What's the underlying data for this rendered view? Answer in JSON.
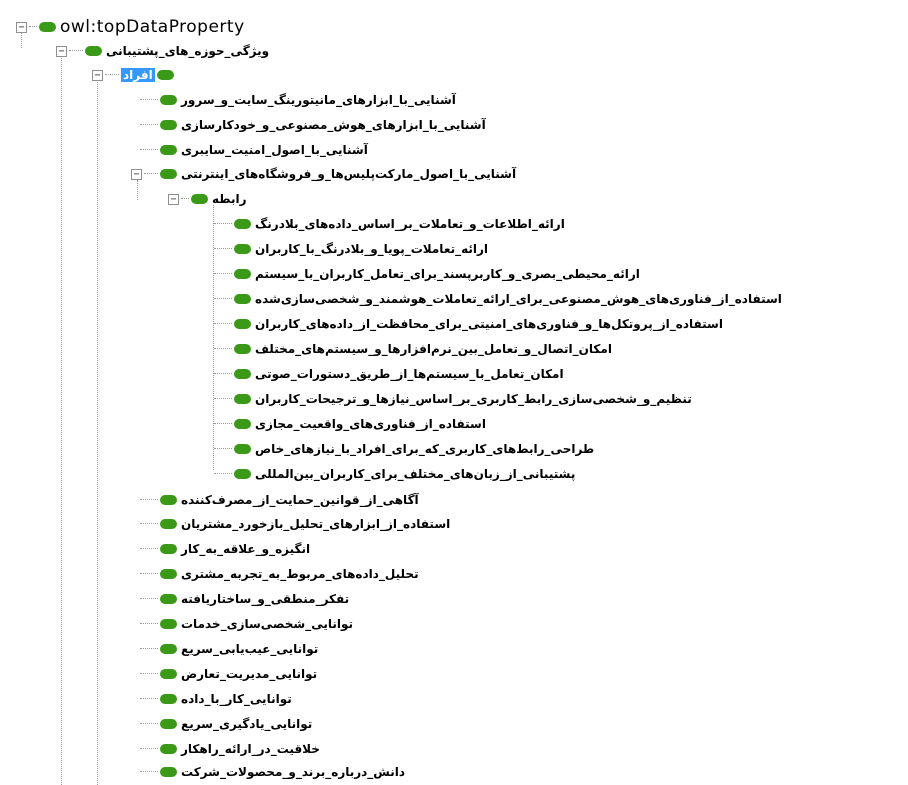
{
  "tree": {
    "root": {
      "label": "owl:topDataProperty"
    },
    "level1": {
      "label": "ویژگی_حوزه_های_پشتیبانی"
    },
    "selected": {
      "label": "افراد"
    },
    "children": [
      {
        "label": "آشنایی_با_ابزارهای_مانیتورینگ_سایت_و_سرور"
      },
      {
        "label": "آشنایی_با_ابزارهای_هوش_مصنوعی_و_خودکارسازی"
      },
      {
        "label": "آشنایی_با_اصول_امنیت_سایبری"
      },
      {
        "label": "آشنایی_با_اصول_مارکت‌پلیس‌ها_و_فروشگاه‌های_اینترنتی"
      }
    ],
    "interface": {
      "label": "رابطه"
    },
    "interface_children": [
      {
        "label": "ارائه_اطلاعات_و_تعاملات_بر_اساس_داده‌های_بلادرنگ"
      },
      {
        "label": "ارائه_تعاملات_پویا_و_بلادرنگ_با_کاربران"
      },
      {
        "label": "ارائه_محیطی_بصری_و_کاربرپسند_برای_تعامل_کاربران_با_سیستم"
      },
      {
        "label": "استفاده_از_فناوری‌های_هوش_مصنوعی_برای_ارائه_تعاملات_هوشمند_و_شخصی‌سازی‌شده"
      },
      {
        "label": "استفاده_از_پروتکل‌ها_و_فناوری‌های_امنیتی_برای_محافظت_از_داده‌های_کاربران"
      },
      {
        "label": "امکان_اتصال_و_تعامل_بین_نرم‌افزارها_و_سیستم‌های_مختلف"
      },
      {
        "label": "امکان_تعامل_با_سیستم‌ها_از_طریق_دستورات_صوتی"
      },
      {
        "label": "تنظیم_و_شخصی‌سازی_رابط_کاربری_بر_اساس_نیازها_و_ترجیحات_کاربران"
      },
      {
        "label": "استفاده_از_فناوری‌های_واقعیت_مجازی"
      },
      {
        "label": "طراحی_رابط‌های_کاربری_که_برای_افراد_با_نیازهای_خاص"
      },
      {
        "label": "پشتیبانی_از_زبان‌های_مختلف_برای_کاربران_بین‌المللی"
      }
    ],
    "more_children": [
      {
        "label": "آگاهی_از_قوانین_حمایت_از_مصرف‌کننده"
      },
      {
        "label": "استفاده_از_ابزارهای_تحلیل_بازخورد_مشتریان"
      },
      {
        "label": "انگیزه_و_علاقه_به_کار"
      },
      {
        "label": "تحلیل_داده‌های_مربوط_به_تجربه_مشتری"
      },
      {
        "label": "تفکر_منطقی_و_ساختاریافته"
      },
      {
        "label": "توانایی_شخصی‌سازی_خدمات"
      },
      {
        "label": "توانایی_عیب‌یابی_سریع"
      },
      {
        "label": "توانایی_مدیریت_تعارض"
      },
      {
        "label": "توانایی_کار_با_داده"
      },
      {
        "label": "توانایی_یادگیری_سریع"
      },
      {
        "label": "خلاقیت_در_ارائه_راهکار"
      },
      {
        "label": "دانش_درباره_برند_و_محصولات_شرکت"
      }
    ],
    "colors": {
      "bullet": "#3a9a18",
      "selection": "#3399ff"
    },
    "icons": {
      "expand_toggle": "minus-toggle-icon",
      "property_bullet": "green-property-icon"
    }
  }
}
